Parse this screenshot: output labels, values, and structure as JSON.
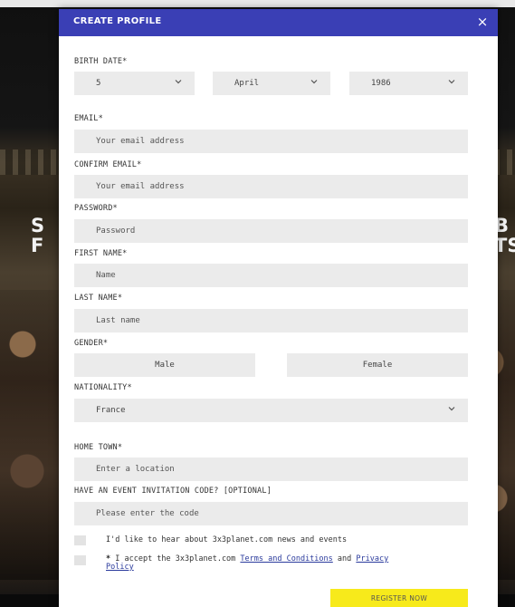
{
  "background": {
    "heading_left": "S",
    "heading_left_line2": "F",
    "heading_right": "B",
    "heading_right_line2": "TS"
  },
  "modal": {
    "title": "CREATE PROFILE",
    "close_label": "×",
    "accent_color": "#3a3fb5",
    "button_color": "#f7ea1b"
  },
  "birth_date": {
    "label": "BIRTH DATE*",
    "day": "5",
    "month": "April",
    "year": "1986"
  },
  "email": {
    "label": "EMAIL*",
    "placeholder": "Your email address"
  },
  "confirm_email": {
    "label": "CONFIRM EMAIL*",
    "placeholder": "Your email address"
  },
  "password": {
    "label": "PASSWORD*",
    "placeholder": "Password"
  },
  "first_name": {
    "label": "FIRST NAME*",
    "placeholder": "Name"
  },
  "last_name": {
    "label": "LAST NAME*",
    "placeholder": "Last name"
  },
  "gender": {
    "label": "GENDER*",
    "options": [
      "Male",
      "Female"
    ]
  },
  "nationality": {
    "label": "NATIONALITY*",
    "value": "France"
  },
  "home_town": {
    "label": "HOME TOWN*",
    "placeholder": "Enter a location"
  },
  "invitation": {
    "label": "HAVE AN EVENT INVITATION CODE? [OPTIONAL]",
    "placeholder": "Please enter the code"
  },
  "newsletter": {
    "text": "I'd like to hear about 3x3planet.com news and events"
  },
  "terms": {
    "star": "*",
    "prefix": " I accept the 3x3planet.com ",
    "terms_link": "Terms and Conditions",
    "middle": " and ",
    "privacy_link_1": "Privacy",
    "privacy_link_2": "Policy"
  },
  "submit": {
    "label": "REGISTER NOW"
  }
}
